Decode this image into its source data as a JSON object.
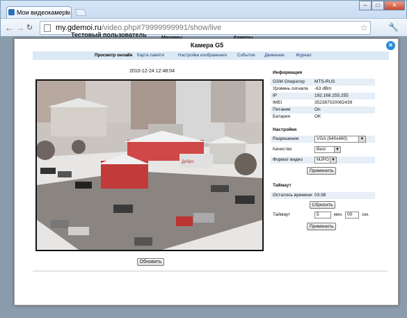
{
  "browser": {
    "tab_title": "Мои видеокамеры",
    "tab_close": "×",
    "url_host": "my.gdemoi.ru",
    "url_path": "/video.php#79999999991/show/live"
  },
  "background_page": {
    "user_name": "Тестовый пользователь",
    "nav_items": [
      "Машины",
      "Камеры"
    ]
  },
  "modal": {
    "title": "Камера G5",
    "close_label": "×",
    "tabs": [
      {
        "label": "Просмотр онлайн",
        "active": true
      },
      {
        "label": "Карта памяти",
        "active": false
      },
      {
        "label": "Настройки изображения",
        "active": false
      },
      {
        "label": "События",
        "active": false
      },
      {
        "label": "Движение",
        "active": false
      },
      {
        "label": "Журнал",
        "active": false
      }
    ],
    "timestamp": "2010-12-24 12:48:04",
    "refresh_button": "Обновить"
  },
  "info": {
    "title": "Информация",
    "rows": [
      {
        "key": "GSM Оператор",
        "value": "MTS-RUS"
      },
      {
        "key": "Уровень сигнала",
        "value": "-63 dBm"
      },
      {
        "key": "IP",
        "value": "192.168.255.255"
      },
      {
        "key": "IMEI",
        "value": "352387020082439"
      },
      {
        "key": "Питание",
        "value": "On"
      },
      {
        "key": "Батарея",
        "value": "OK"
      }
    ]
  },
  "settings": {
    "title": "Настройки",
    "resolution_label": "Разрешение",
    "resolution_value": "VGA (640x480)",
    "quality_label": "Качество",
    "quality_value": "Best",
    "format_label": "Формат видео",
    "format_value": "MJPG",
    "apply_button": "Применить"
  },
  "timeout": {
    "title": "Таймаут",
    "remaining_label": "Осталось времени",
    "remaining_value": "03:38",
    "reset_button": "Сбросить",
    "timeout_label": "Таймаут",
    "minutes_value": "5",
    "minutes_unit": "мин.",
    "seconds_value": "00",
    "seconds_unit": "сек.",
    "apply_button": "Применить"
  }
}
